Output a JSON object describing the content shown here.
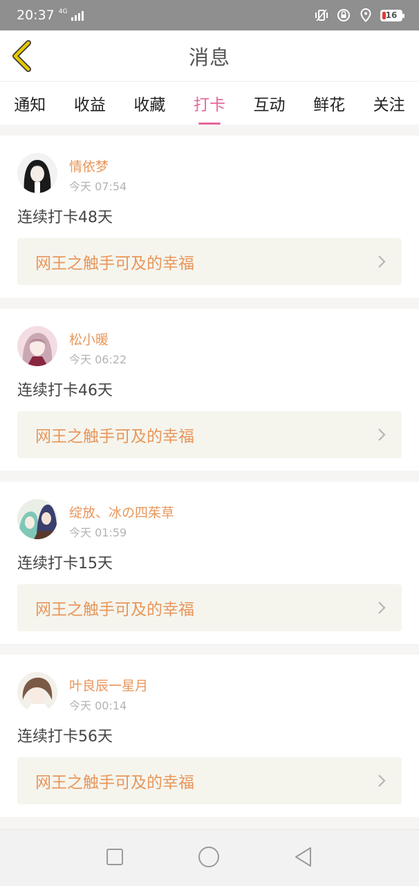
{
  "status_bar": {
    "time": "20:37",
    "network": "4G",
    "battery": "16"
  },
  "header": {
    "title": "消息"
  },
  "tabs": [
    {
      "label": "通知"
    },
    {
      "label": "收益"
    },
    {
      "label": "收藏"
    },
    {
      "label": "打卡",
      "active": true
    },
    {
      "label": "互动"
    },
    {
      "label": "鲜花"
    },
    {
      "label": "关注"
    }
  ],
  "feed": [
    {
      "user": "情依梦",
      "time": "今天 07:54",
      "text": "连续打卡48天",
      "book": "网王之触手可及的幸福"
    },
    {
      "user": "松小暖",
      "time": "今天 06:22",
      "text": "连续打卡46天",
      "book": "网王之触手可及的幸福"
    },
    {
      "user": "绽放、冰の四茱草",
      "time": "今天 01:59",
      "text": "连续打卡15天",
      "book": "网王之触手可及的幸福"
    },
    {
      "user": "叶良辰一星月",
      "time": "今天 00:14",
      "text": "连续打卡56天",
      "book": "网王之触手可及的幸福"
    }
  ],
  "colors": {
    "accent": "#e5689b",
    "name": "#e8965a",
    "back_icon": "#d4b400"
  },
  "icons": [
    "back-chevron-icon",
    "chevron-right-icon",
    "square-icon",
    "circle-icon",
    "triangle-back-icon"
  ]
}
